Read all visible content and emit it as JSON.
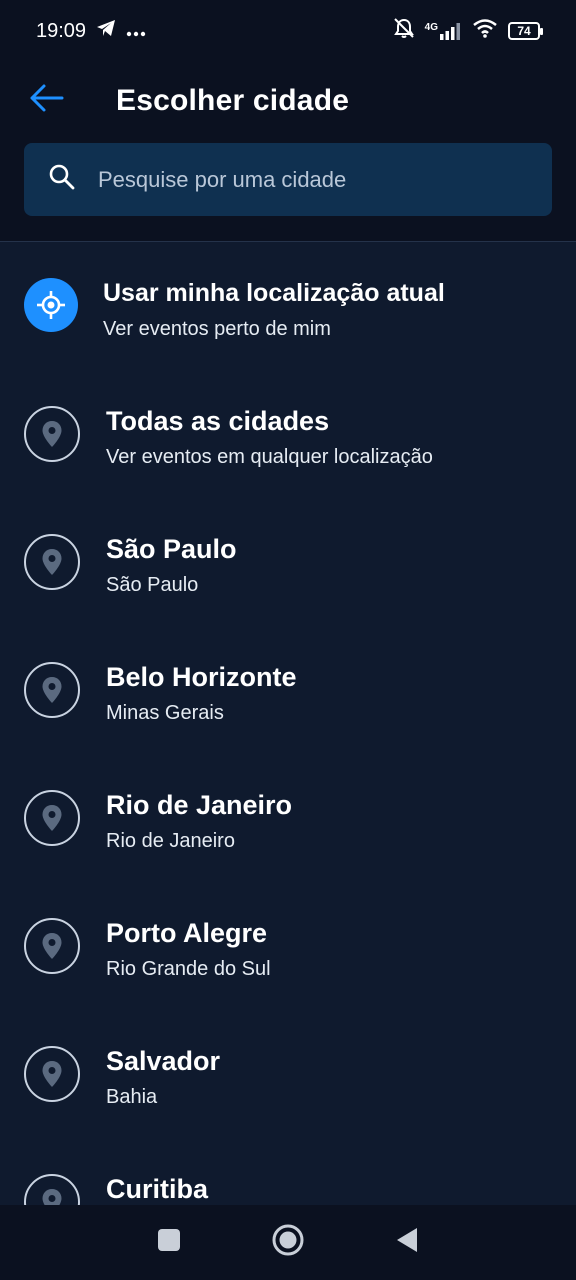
{
  "status_bar": {
    "time": "19:09",
    "battery": "74",
    "network": "4G",
    "icons": [
      "telegram-icon",
      "more-dots-icon",
      "bell-off-icon",
      "signal-icon",
      "wifi-icon",
      "battery-icon"
    ]
  },
  "header": {
    "title": "Escolher cidade",
    "back_icon": "arrow-left-icon"
  },
  "search": {
    "placeholder": "Pesquise por uma cidade",
    "value": ""
  },
  "current_location": {
    "title": "Usar minha localização atual",
    "subtitle": "Ver eventos perto de mim"
  },
  "cities": [
    {
      "name": "Todas as cidades",
      "state": "Ver eventos em qualquer localização"
    },
    {
      "name": "São Paulo",
      "state": "São Paulo"
    },
    {
      "name": "Belo Horizonte",
      "state": "Minas Gerais"
    },
    {
      "name": "Rio de Janeiro",
      "state": "Rio de Janeiro"
    },
    {
      "name": "Porto Alegre",
      "state": "Rio Grande do Sul"
    },
    {
      "name": "Salvador",
      "state": "Bahia"
    },
    {
      "name": "Curitiba",
      "state": ""
    }
  ],
  "colors": {
    "accent": "#1e90ff",
    "background": "#0f1a2e",
    "header": "#0b1120",
    "search_bg": "#0f3050"
  },
  "nav_bar": {
    "buttons": [
      "recents-square-icon",
      "home-circle-icon",
      "back-triangle-icon"
    ]
  }
}
